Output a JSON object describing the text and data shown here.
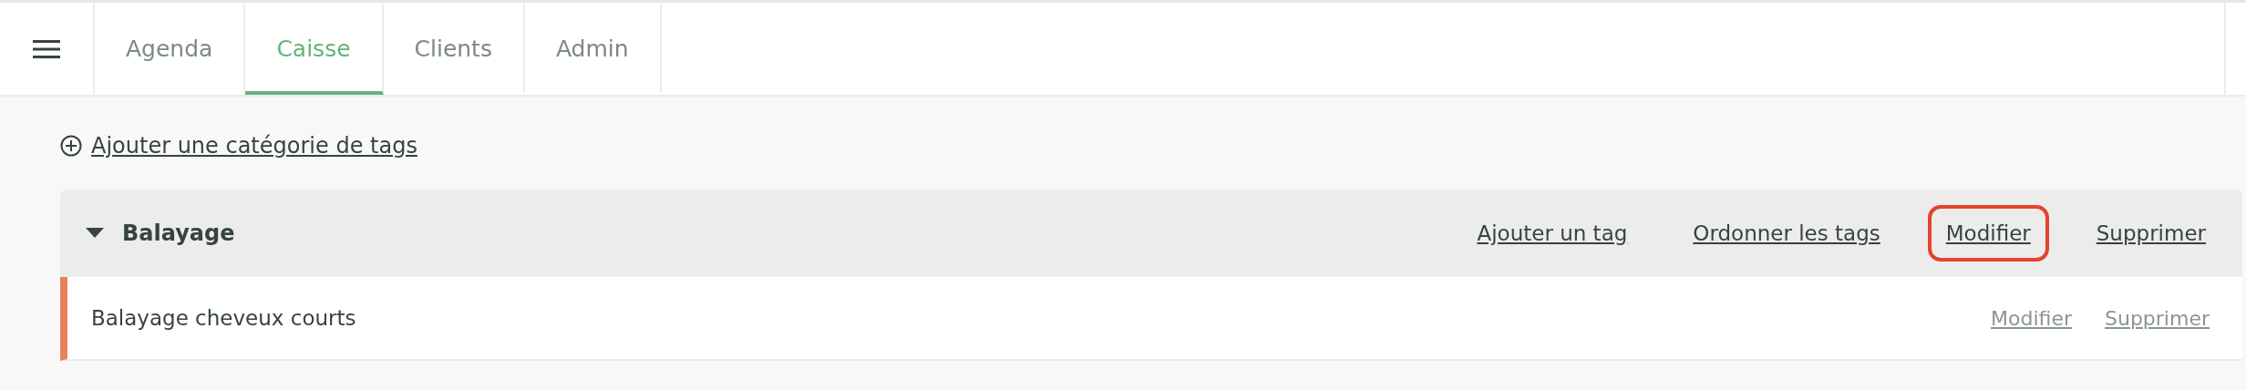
{
  "tabs": [
    {
      "label": "Agenda",
      "selected": false
    },
    {
      "label": "Caisse",
      "selected": true
    },
    {
      "label": "Clients",
      "selected": false
    },
    {
      "label": "Admin",
      "selected": false
    }
  ],
  "add_category": "Ajouter une catégorie de tags",
  "categories": [
    {
      "name": "Balayage",
      "expanded": true,
      "actions": [
        {
          "label": "Ajouter un tag",
          "highlighted": false
        },
        {
          "label": "Ordonner les tags",
          "highlighted": false
        },
        {
          "label": "Modifier",
          "highlighted": true
        },
        {
          "label": "Supprimer",
          "highlighted": false
        }
      ],
      "tags": [
        {
          "name": "Balayage cheveux courts",
          "color": "#e8825a",
          "actions": [
            "Modifier",
            "Supprimer"
          ]
        }
      ]
    }
  ]
}
